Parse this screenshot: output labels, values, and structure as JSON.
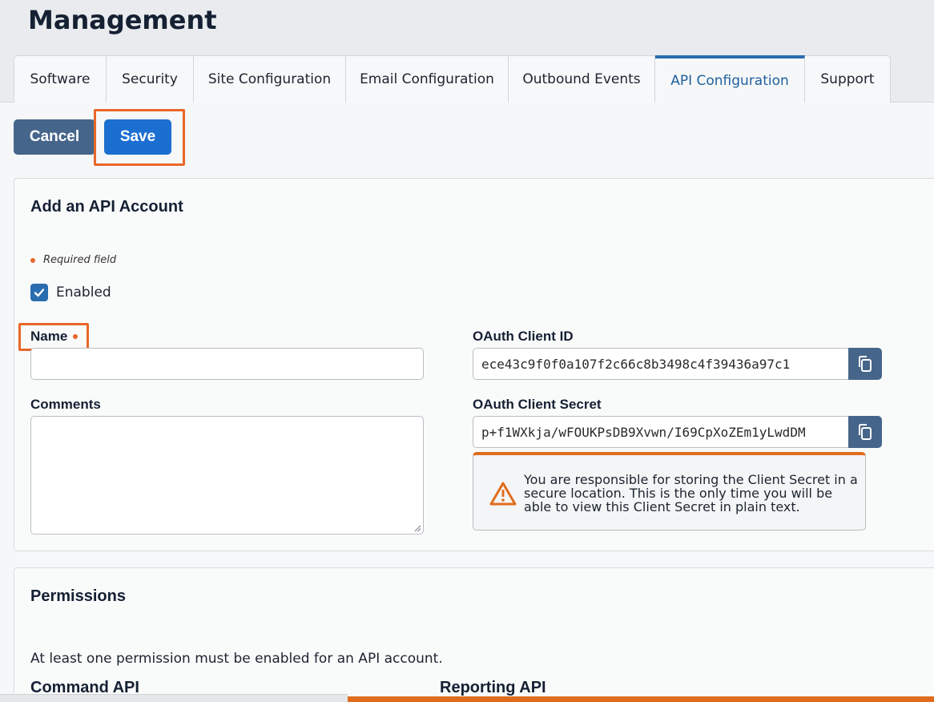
{
  "page": {
    "title": "Management"
  },
  "tabs": [
    {
      "label": "Software"
    },
    {
      "label": "Security"
    },
    {
      "label": "Site Configuration"
    },
    {
      "label": "Email Configuration"
    },
    {
      "label": "Outbound Events"
    },
    {
      "label": "API Configuration",
      "active": true
    },
    {
      "label": "Support"
    }
  ],
  "actions": {
    "cancel_label": "Cancel",
    "save_label": "Save"
  },
  "account_form": {
    "title": "Add an API Account",
    "required_note": "Required field",
    "enabled_label": "Enabled",
    "enabled_checked": true,
    "name_label": "Name",
    "name_value": "",
    "comments_label": "Comments",
    "comments_value": "",
    "client_id_label": "OAuth Client ID",
    "client_id_value": "ece43c9f0f0a107f2c66c8b3498c4f39436a97c1",
    "client_secret_label": "OAuth Client Secret",
    "client_secret_value": "p+f1WXkja/wFOUKPsDB9Xvwn/I69CpXoZEm1yLwdDM",
    "warning_text": "You are responsible for storing the Client Secret in a secure location. This is the only time you will be able to view this Client Secret in plain text."
  },
  "permissions": {
    "title": "Permissions",
    "note": "At least one permission must be enabled for an API account.",
    "command_api_label": "Command API",
    "reporting_api_label": "Reporting API"
  },
  "colors": {
    "accent": "#2a6db0",
    "save_button": "#1b6fd1",
    "cancel_button": "#46658a",
    "highlight": "#e8672a",
    "warning": "#e06d1e"
  },
  "icons": {
    "copy": "copy-icon",
    "warning": "warning-triangle-icon",
    "check": "checkmark-icon"
  }
}
